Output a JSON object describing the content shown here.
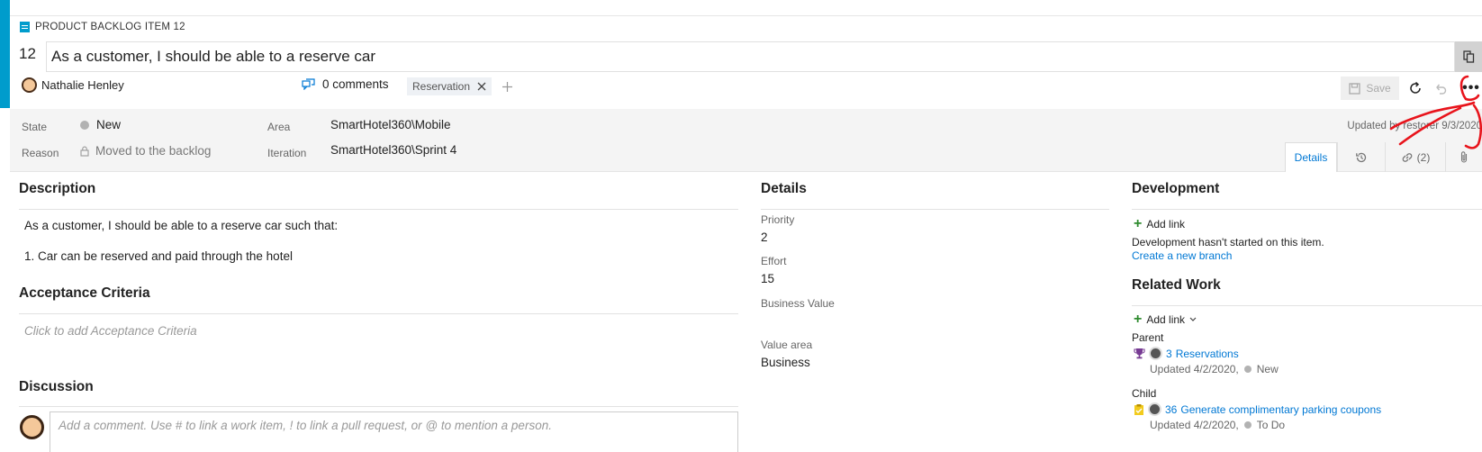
{
  "header": {
    "item_type": "PRODUCT BACKLOG ITEM 12",
    "id": "12",
    "title": "As a customer, I should be able to a reserve car",
    "assignee": "Nathalie Henley",
    "comments": "0 comments",
    "tags": [
      "Reservation"
    ],
    "save_label": "Save"
  },
  "fields": {
    "state_label": "State",
    "state_value": "New",
    "reason_label": "Reason",
    "reason_value": "Moved to the backlog",
    "area_label": "Area",
    "area_value": "SmartHotel360\\Mobile",
    "iteration_label": "Iteration",
    "iteration_value": "SmartHotel360\\Sprint 4",
    "updated": "Updated by restorer 9/3/2020"
  },
  "tabs": {
    "details": "Details",
    "links": "(2)"
  },
  "description": {
    "title": "Description",
    "line1": "As a customer, I should be able to a reserve car such that:",
    "line2": "1. Car can be reserved and paid through the hotel"
  },
  "acceptance": {
    "title": "Acceptance Criteria",
    "placeholder": "Click to add Acceptance Criteria"
  },
  "discussion": {
    "title": "Discussion",
    "placeholder": "Add a comment. Use # to link a work item, ! to link a pull request, or @ to mention a person."
  },
  "details": {
    "title": "Details",
    "priority_label": "Priority",
    "priority_value": "2",
    "effort_label": "Effort",
    "effort_value": "15",
    "business_value_label": "Business Value",
    "value_area_label": "Value area",
    "value_area_value": "Business"
  },
  "development": {
    "title": "Development",
    "add_link": "Add link",
    "status": "Development hasn't started on this item.",
    "create_branch": "Create a new branch"
  },
  "related": {
    "title": "Related Work",
    "add_link": "Add link",
    "parent_label": "Parent",
    "parent_id": "3",
    "parent_title": "Reservations",
    "parent_updated": "Updated 4/2/2020,",
    "parent_state": "New",
    "child_label": "Child",
    "child_id": "36",
    "child_title": "Generate complimentary parking coupons",
    "child_updated": "Updated 4/2/2020,",
    "child_state": "To Do"
  },
  "colors": {
    "accent": "#009ccc",
    "link": "#0078d4",
    "annotation": "#e8141c"
  },
  "icons": {
    "item_type": "backlog-item-icon",
    "copy": "copy-icon",
    "comment": "comment-icon",
    "save": "save-icon",
    "refresh": "refresh-icon",
    "undo": "undo-icon",
    "more": "more-icon",
    "lock": "lock-icon",
    "history": "history-icon",
    "links": "link-icon",
    "attachment": "attachment-icon",
    "parent_type": "trophy-icon",
    "child_type": "clipboard-icon"
  }
}
